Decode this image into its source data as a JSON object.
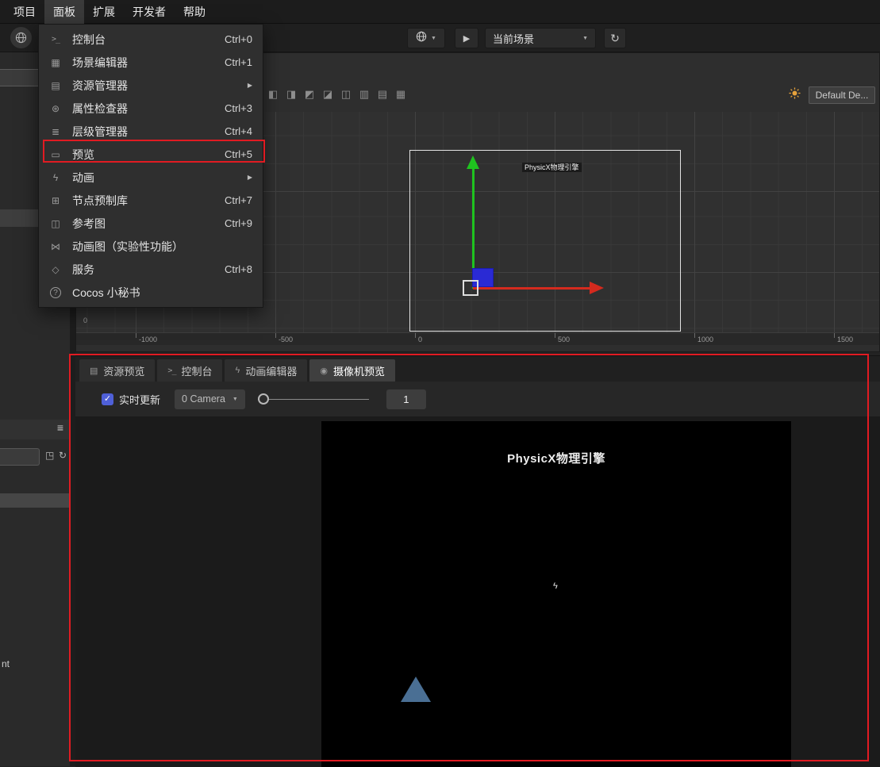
{
  "menubar": {
    "items": [
      {
        "label": "项目"
      },
      {
        "label": "面板"
      },
      {
        "label": "扩展"
      },
      {
        "label": "开发者"
      },
      {
        "label": "帮助"
      }
    ]
  },
  "panel_menu": {
    "items": [
      {
        "label": "控制台",
        "shortcut": "Ctrl+0"
      },
      {
        "label": "场景编辑器",
        "shortcut": "Ctrl+1"
      },
      {
        "label": "资源管理器",
        "shortcut": ""
      },
      {
        "label": "属性检查器",
        "shortcut": "Ctrl+3"
      },
      {
        "label": "层级管理器",
        "shortcut": "Ctrl+4"
      },
      {
        "label": "预览",
        "shortcut": "Ctrl+5"
      },
      {
        "label": "动画",
        "shortcut": ""
      },
      {
        "label": "节点预制库",
        "shortcut": "Ctrl+7"
      },
      {
        "label": "参考图",
        "shortcut": "Ctrl+9"
      },
      {
        "label": "动画图（实验性功能）",
        "shortcut": ""
      },
      {
        "label": "服务",
        "shortcut": "Ctrl+8"
      },
      {
        "label": "Cocos 小秘书",
        "shortcut": ""
      }
    ]
  },
  "toolbar": {
    "scene_select": "当前场景"
  },
  "scene_view": {
    "device_button": "Default De...",
    "frame_label": "PhysicX物理引擎",
    "ruler_h": [
      "-1000",
      "-500",
      "0",
      "500",
      "1000",
      "1500"
    ],
    "ruler_origin": "0"
  },
  "bottom_panel": {
    "tabs": [
      {
        "label": "资源预览"
      },
      {
        "label": "控制台"
      },
      {
        "label": "动画编辑器"
      },
      {
        "label": "摄像机预览"
      }
    ],
    "controls": {
      "realtime": "实时更新",
      "camera": "0 Camera",
      "value": "1"
    },
    "preview_title": "PhysicX物理引擎"
  },
  "left_panel": {
    "partial_text": "nt"
  },
  "icons": {
    "submenu_arrow": "▶",
    "caret_down": "▼",
    "play": "▶",
    "refresh": "↻",
    "hamburger": "≡",
    "check": "✓",
    "console": ">_",
    "scene_editor": "▦",
    "assets": "▤",
    "inspector": "⊛",
    "hierarchy": "≣",
    "preview": "▭",
    "animation": "ϟ",
    "node_library": "⊞",
    "reference_image": "◫",
    "animation_graph": "⋈",
    "service": "◇",
    "assistant": "?",
    "folder": "▤",
    "animation_editor": "ϟ",
    "camera": "◉",
    "expand": "◳",
    "reset": "↻",
    "lightning_sprite": "ϟ",
    "align": [
      "◧",
      "◨",
      "◩",
      "◪",
      "◫",
      "▥",
      "▤",
      "▦"
    ]
  },
  "colors": {
    "annotation_red": "#e11b22",
    "checkbox_blue": "#4f60d8",
    "axis_green": "#1fc31f",
    "axis_red": "#d42a1e",
    "node_blue": "#2a2ad4",
    "triangle_blue": "#4a6f94",
    "light_icon_orange": "#e6a23c"
  }
}
